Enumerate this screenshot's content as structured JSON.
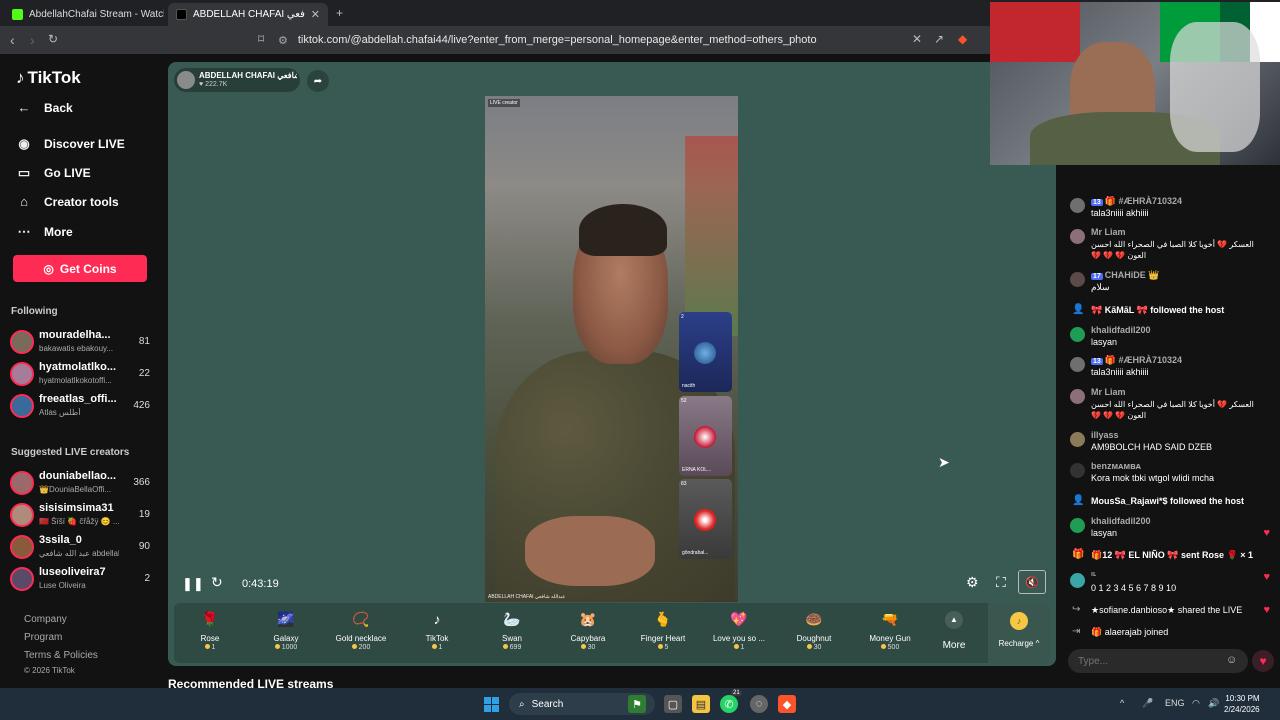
{
  "browser": {
    "tabs": [
      {
        "title": "AbdellahChafai Stream - Watch Live"
      },
      {
        "title": "ABDELLAH CHAFAI عبدالله شافعي"
      }
    ],
    "new_tab": "+",
    "url": "tiktok.com/@abdellah.chafai44/live?enter_from_merge=personal_homepage&enter_method=others_photo"
  },
  "sidebar": {
    "logo": "TikTok",
    "back": "Back",
    "nav": [
      {
        "label": "Discover LIVE",
        "icon": "discover-live-icon"
      },
      {
        "label": "Go LIVE",
        "icon": "video-camera-icon"
      },
      {
        "label": "Creator tools",
        "icon": "home-icon"
      },
      {
        "label": "More",
        "icon": "ellipsis-icon"
      }
    ],
    "get_coins": "Get Coins",
    "following_title": "Following",
    "following": [
      {
        "name": "mouradelha...",
        "sub": "bakawatis ebakouy...",
        "count": "81"
      },
      {
        "name": "hyatmolatlko...",
        "sub": "hyatmolatlkokotoffi...",
        "count": "22"
      },
      {
        "name": "freeatlas_offi...",
        "sub": "Atlas أطلس",
        "count": "426"
      }
    ],
    "suggested_title": "Suggested LIVE creators",
    "suggested": [
      {
        "name": "douniabellao...",
        "sub": "👑DouniaBellaOffi...",
        "count": "366"
      },
      {
        "name": "sisisimsima31",
        "sub": "🇲🇦 Šïšï 🍓 ĉřåžÿ 😊 ...",
        "count": "19"
      },
      {
        "name": "3ssila_0",
        "sub": "عبد الله شافعي abdellah...",
        "count": "90"
      },
      {
        "name": "luseoliveira7",
        "sub": "Luse Oliveira",
        "count": "2"
      }
    ],
    "footer": [
      "Company",
      "Program",
      "Terms & Policies",
      "© 2026 TikTok"
    ]
  },
  "stream": {
    "host_name": "ABDELLAH CHAFAI عبدالله شافعي",
    "likes": "222.7K",
    "live_tag": "LIVE creator",
    "video_caption": "ABDELLAH CHAFAI عبدالله شافعي",
    "guests": [
      {
        "count": "2",
        "name": "nacith"
      },
      {
        "count": "52",
        "name": "ERNA KOL..."
      },
      {
        "count": "83",
        "name": "gôndrabal..."
      }
    ],
    "time": "0:43:19"
  },
  "gifts": [
    {
      "name": "Rose",
      "price": "1",
      "icon": "🌹"
    },
    {
      "name": "Galaxy",
      "price": "1000",
      "icon": "🌌"
    },
    {
      "name": "Gold necklace",
      "price": "200",
      "icon": "📿"
    },
    {
      "name": "TikTok",
      "price": "1",
      "icon": "♪"
    },
    {
      "name": "Swan",
      "price": "699",
      "icon": "🦢"
    },
    {
      "name": "Capybara",
      "price": "30",
      "icon": "🐹"
    },
    {
      "name": "Finger Heart",
      "price": "5",
      "icon": "🫰"
    },
    {
      "name": "Love you so ...",
      "price": "1",
      "icon": "💖"
    },
    {
      "name": "Doughnut",
      "price": "30",
      "icon": "🍩"
    },
    {
      "name": "Money Gun",
      "price": "500",
      "icon": "🔫"
    }
  ],
  "gift_more": "More",
  "recharge": "Recharge",
  "recommended_title": "Recommended LIVE streams",
  "chat": {
    "messages": [
      {
        "badge": "13",
        "user": "🎁 #ÆHRÀ710324",
        "text": "tala3niiii akhiiii",
        "color": "#6f6f6f"
      },
      {
        "badge": "",
        "user": "Mr Liam",
        "text": "العسكر 💔 أخويا كلا الصبا في الصحراء الله احسن العون 💔 💔 💔",
        "color": "#8d6f7a"
      },
      {
        "badge": "17",
        "user": "CHAHiDE 👑",
        "text": "سلام",
        "color": "#5c4a4a"
      },
      {
        "badge": "13",
        "user": "🎁 #ÆHRÀ710324",
        "text": "tala3niiii akhiiii",
        "color": "#6f6f6f"
      },
      {
        "badge": "",
        "user": "Mr Liam",
        "text": "العسكر 💔 أخويا كلا الصبا في الصحراء الله احسن العون 💔 💔 💔",
        "color": "#8d6f7a"
      },
      {
        "badge": "",
        "user": "illyass",
        "text": "AM9BOLCH HAD SAID DZEB",
        "color": "#8a7a5a"
      },
      {
        "badge": "",
        "user": "benzᴍᴀᴍʙᴀ",
        "text": "Kora mok tbki wtgol wlidi mcha",
        "color": "#333"
      },
      {
        "badge": "",
        "user": "khalidfadil200",
        "text": "lasyan",
        "color": "#1f9d55"
      },
      {
        "badge": "",
        "user": "ıʟ",
        "text": "0 1 2 3 4 5 6 7 8 9 10",
        "color": "#3aa6a6"
      }
    ],
    "khalid1": {
      "user": "khalidfadil200",
      "text": "lasyan"
    },
    "system": [
      {
        "text": "🎀 KāMāL 🎀 followed the host"
      },
      {
        "text": "MousSa_Rajawi*$ followed the host"
      },
      {
        "text": "🎁12 🎀 EL NIÑO 🎀 sent Rose 🌹 × 1"
      },
      {
        "text": "★sofiane.danbioso★ shared the LIVE"
      },
      {
        "text": "🎁 alaerajab joined"
      }
    ],
    "input_placeholder": "Type..."
  },
  "taskbar": {
    "search": "Search",
    "lang": "ENG",
    "time": "10:30 PM",
    "date": "2/24/2026",
    "notif_badge": "21"
  }
}
